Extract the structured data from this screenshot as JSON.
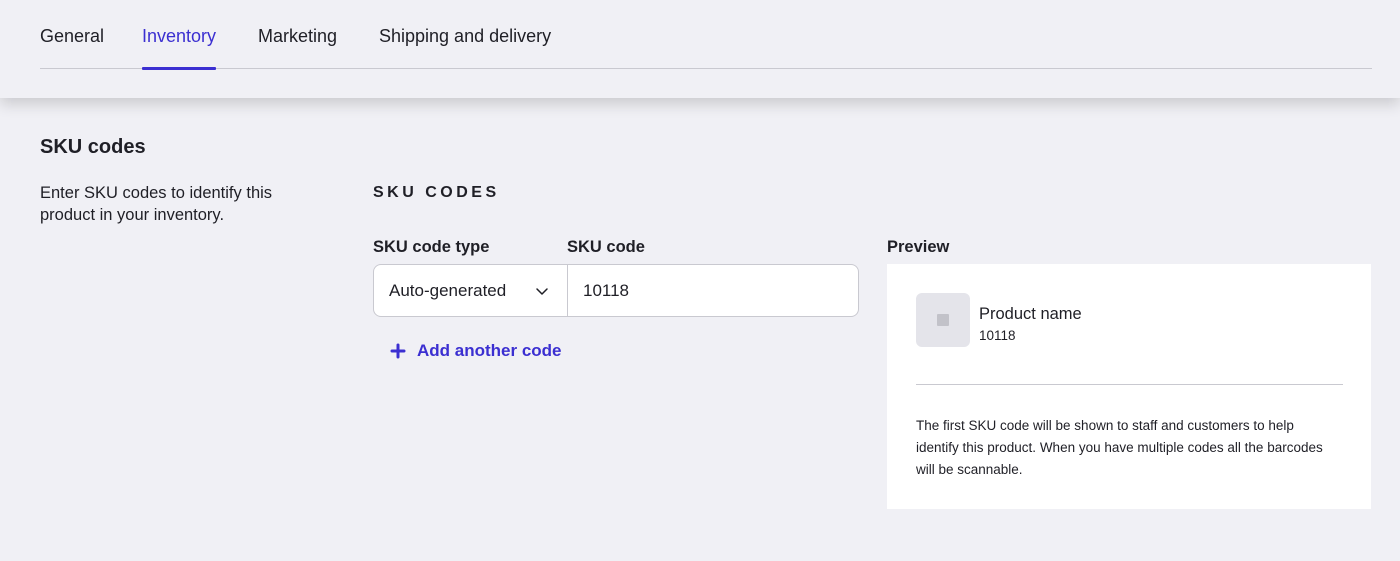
{
  "tabs": [
    {
      "label": "General",
      "active": false
    },
    {
      "label": "Inventory",
      "active": true
    },
    {
      "label": "Marketing",
      "active": false
    },
    {
      "label": "Shipping and delivery",
      "active": false
    }
  ],
  "section": {
    "title": "SKU codes",
    "description": "Enter SKU codes to identify this product in your inventory."
  },
  "sku_form": {
    "heading": "SKU CODES",
    "type_label": "SKU code type",
    "code_label": "SKU code",
    "type_value": "Auto-generated",
    "code_value": "10118",
    "add_label": "Add another code"
  },
  "preview": {
    "label": "Preview",
    "product_name": "Product name",
    "sku": "10118",
    "note": "The first SKU code will be shown to staff and customers to help identify this product. When you have multiple codes all the barcodes will be scannable."
  },
  "icons": {
    "select_chevron": "chevron-down-icon",
    "add": "plus-icon",
    "thumbnail": "image-placeholder-icon"
  },
  "colors": {
    "accent": "#3b2fd1",
    "background": "#f0f0f5",
    "card": "#ffffff",
    "border": "#c9c9d0"
  }
}
